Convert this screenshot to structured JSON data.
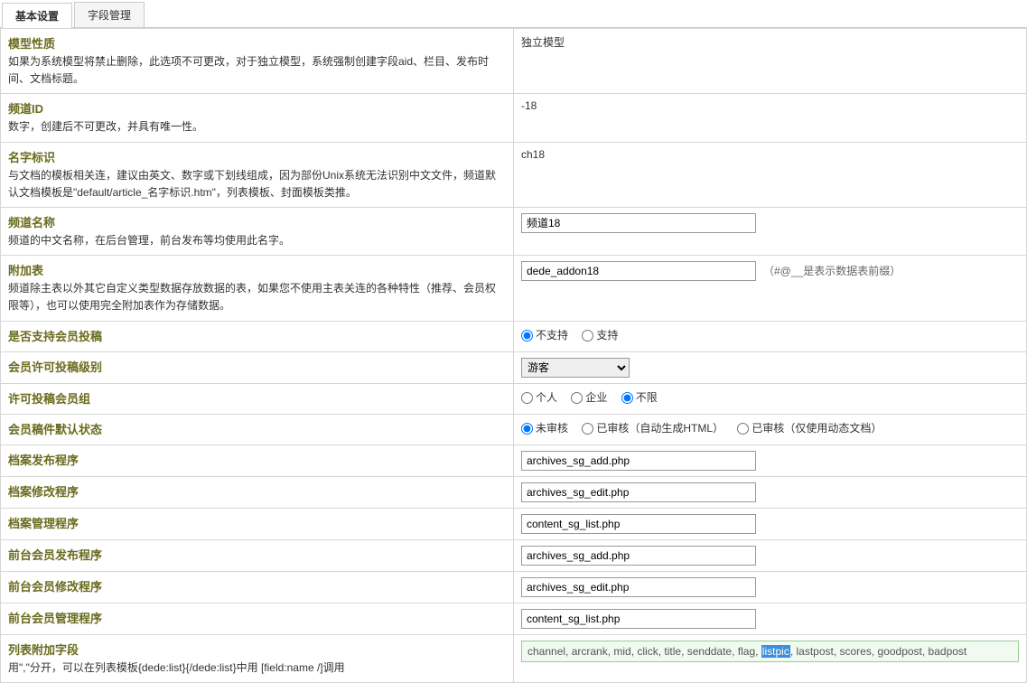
{
  "tabs": {
    "basic": "基本设置",
    "fields": "字段管理"
  },
  "rows": {
    "modelType": {
      "label": "模型性质",
      "desc": "如果为系统模型将禁止删除，此选项不可更改，对于独立模型，系统强制创建字段aid、栏目、发布时间、文档标题。",
      "value": "独立模型"
    },
    "channelId": {
      "label": "频道ID",
      "desc": "数字，创建后不可更改，并具有唯一性。",
      "value": "-18"
    },
    "nameId": {
      "label": "名字标识",
      "desc": "与文档的模板相关连，建议由英文、数字或下划线组成，因为部份Unix系统无法识别中文文件，频道默认文档模板是\"default/article_名字标识.htm\"，列表模板、封面模板类推。",
      "value": "ch18"
    },
    "channelName": {
      "label": "频道名称",
      "desc": "频道的中文名称，在后台管理，前台发布等均使用此名字。",
      "value": "频道18"
    },
    "addonTable": {
      "label": "附加表",
      "desc": "频道除主表以外其它自定义类型数据存放数据的表，如果您不使用主表关连的各种特性（推荐、会员权限等），也可以使用完全附加表作为存储数据。",
      "value": "dede_addon18",
      "note": "（#@__是表示数据表前缀）"
    },
    "memberSubmit": {
      "label": "是否支持会员投稿",
      "opt1": "不支持",
      "opt2": "支持"
    },
    "submitLevel": {
      "label": "会员许可投稿级别",
      "value": "游客"
    },
    "submitGroup": {
      "label": "许可投稿会员组",
      "opt1": "个人",
      "opt2": "企业",
      "opt3": "不限"
    },
    "draftStatus": {
      "label": "会员稿件默认状态",
      "opt1": "未审核",
      "opt2": "已审核（自动生成HTML）",
      "opt3": "已审核（仅使用动态文档）"
    },
    "arcAdd": {
      "label": "档案发布程序",
      "value": "archives_sg_add.php"
    },
    "arcEdit": {
      "label": "档案修改程序",
      "value": "archives_sg_edit.php"
    },
    "arcList": {
      "label": "档案管理程序",
      "value": "content_sg_list.php"
    },
    "frontAdd": {
      "label": "前台会员发布程序",
      "value": "archives_sg_add.php"
    },
    "frontEdit": {
      "label": "前台会员修改程序",
      "value": "archives_sg_edit.php"
    },
    "frontList": {
      "label": "前台会员管理程序",
      "value": "content_sg_list.php"
    },
    "listFields": {
      "label": "列表附加字段",
      "desc": "用\",\"分开，可以在列表模板{dede:list}{/dede:list}中用 [field:name /]调用",
      "prefix": "channel, arcrank, mid, click, title, senddate, flag, ",
      "highlight": "listpic",
      "suffix": ", lastpost, scores, goodpost, badpost"
    }
  }
}
